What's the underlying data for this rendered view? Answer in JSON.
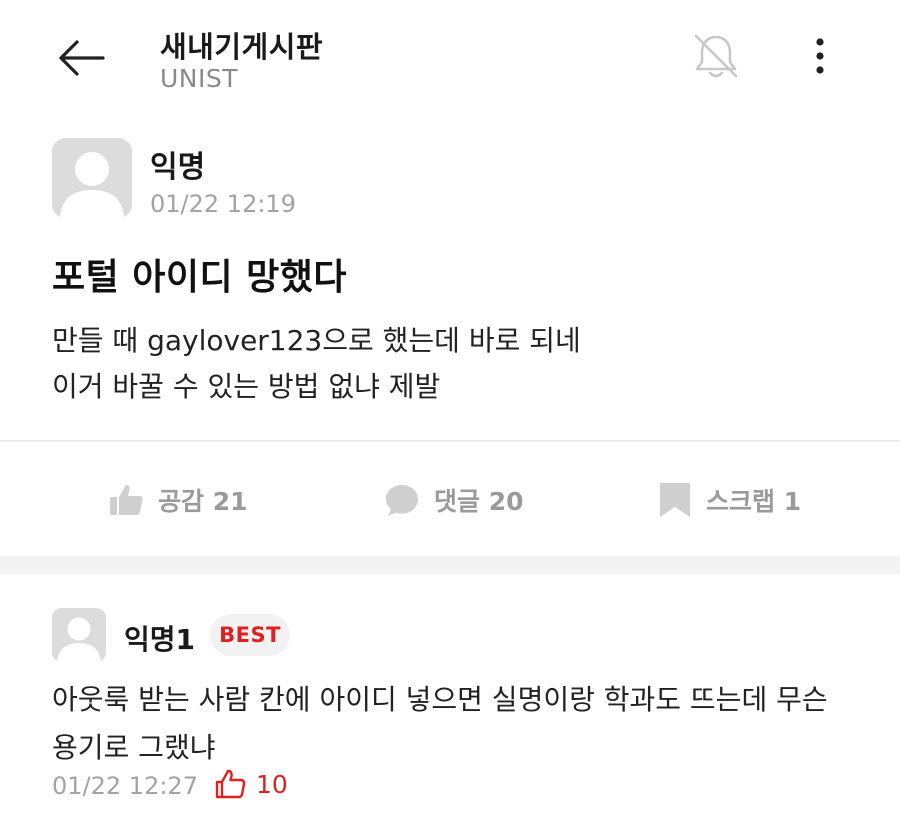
{
  "header": {
    "title": "새내기게시판",
    "subtitle": "UNIST",
    "back_icon": "arrow-left-icon",
    "bell_icon": "bell-off-icon",
    "more_icon": "more-vertical-icon"
  },
  "post": {
    "author": "익명",
    "time": "01/22 12:19",
    "title": "포털 아이디 망했다",
    "body_lines": [
      "만들 때 gaylover123으로 했는데 바로 되네",
      "이거 바꿀 수 있는 방법 없냐 제발"
    ]
  },
  "actions": {
    "like": {
      "label": "공감 21",
      "icon": "thumbs-up-icon"
    },
    "comment": {
      "label": "댓글 20",
      "icon": "comment-icon"
    },
    "scrap": {
      "label": "스크랩 1",
      "icon": "bookmark-icon"
    }
  },
  "comments": [
    {
      "author": "익명1",
      "badge": "BEST",
      "body_lines": [
        "아웃룩 받는 사람 칸에 아이디 넣으면 실명이랑 학과도 뜨는데 무슨",
        "용기로 그랬냐"
      ],
      "time": "01/22 12:27",
      "likes": "10",
      "like_icon": "thumbs-up-outline-icon"
    }
  ],
  "colors": {
    "accent_red": "#e02020",
    "muted_gray": "#9a9a9a",
    "avatar_bg": "#dcdcdc"
  }
}
